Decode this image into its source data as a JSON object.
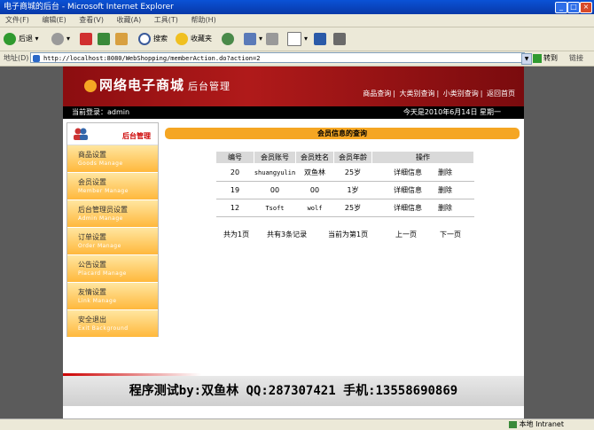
{
  "window": {
    "title": "电子商城的后台 - Microsoft Internet Explorer"
  },
  "menu": [
    "文件(F)",
    "编辑(E)",
    "查看(V)",
    "收藏(A)",
    "工具(T)",
    "帮助(H)"
  ],
  "toolbar": {
    "back": "后退",
    "search": "搜索",
    "favorites": "收藏夹"
  },
  "address": {
    "label": "地址(D)",
    "url": "http://localhost:8080/WebShopping/memberAction.do?action=2",
    "go": "转到",
    "links": "链接"
  },
  "site": {
    "logo": "网络电子商城",
    "logo_sub": "后台管理",
    "nav": [
      "商品查询",
      "大类别查询",
      "小类别查询",
      "返回首页"
    ],
    "login": "当前登录：admin",
    "date": "今天是2010年6月14日 星期一"
  },
  "sidebar": {
    "header": "后台管理",
    "items": [
      {
        "cn": "商品设置",
        "en": "Goods Manage"
      },
      {
        "cn": "会员设置",
        "en": "Member Manage"
      },
      {
        "cn": "后台管理员设置",
        "en": "Admin Manage"
      },
      {
        "cn": "订单设置",
        "en": "Order Manage"
      },
      {
        "cn": "公告设置",
        "en": "Placard Manage"
      },
      {
        "cn": "友情设置",
        "en": "Link Manage"
      },
      {
        "cn": "安全退出",
        "en": "Exit Background"
      }
    ]
  },
  "section_title": "会员信息的查询",
  "table": {
    "headers": [
      "编号",
      "会员账号",
      "会员姓名",
      "会员年龄",
      "操作"
    ],
    "rows": [
      {
        "id": "20",
        "account": "shuangyulin",
        "name": "双鱼林",
        "age": "25岁",
        "detail": "详细信息",
        "del": "删除"
      },
      {
        "id": "19",
        "account": "00",
        "name": "00",
        "age": "1岁",
        "detail": "详细信息",
        "del": "删除"
      },
      {
        "id": "12",
        "account": "Tsoft",
        "name": "wolf",
        "age": "25岁",
        "detail": "详细信息",
        "del": "删除"
      }
    ]
  },
  "pager": {
    "total_pages": "共为1页",
    "total_records": "共有3条记录",
    "current": "当前为第1页",
    "prev": "上一页",
    "next": "下一页"
  },
  "footer": "程序测试by:双鱼林 QQ:287307421 手机:13558690869",
  "status": {
    "zone": "本地 Intranet"
  }
}
